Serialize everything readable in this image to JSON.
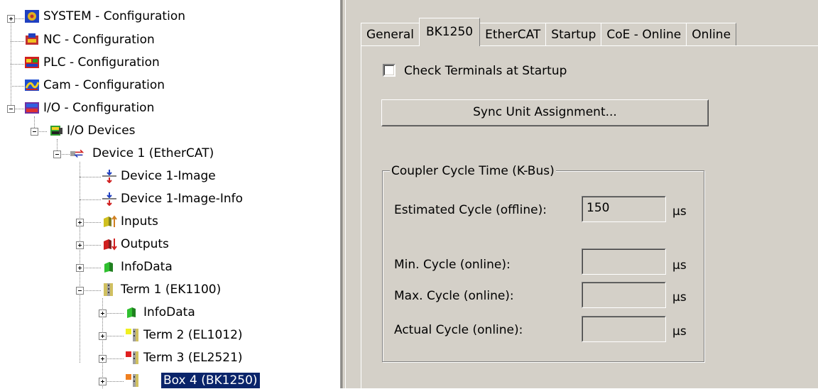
{
  "tree": {
    "nodes": [
      {
        "id": "system",
        "label": "SYSTEM - Configuration",
        "icon": "system-config-icon"
      },
      {
        "id": "nc",
        "label": "NC - Configuration",
        "icon": "nc-config-icon"
      },
      {
        "id": "plc",
        "label": "PLC - Configuration",
        "icon": "plc-config-icon"
      },
      {
        "id": "cam",
        "label": "Cam - Configuration",
        "icon": "cam-config-icon"
      },
      {
        "id": "io",
        "label": "I/O - Configuration",
        "icon": "io-config-icon"
      },
      {
        "id": "io-devices",
        "label": "I/O Devices",
        "icon": "io-devices-icon"
      },
      {
        "id": "device1",
        "label": "Device 1 (EtherCAT)",
        "icon": "ethercat-device-icon"
      },
      {
        "id": "device1-image",
        "label": "Device 1-Image",
        "icon": "process-image-icon"
      },
      {
        "id": "device1-image-info",
        "label": "Device 1-Image-Info",
        "icon": "process-image-icon"
      },
      {
        "id": "inputs",
        "label": "Inputs",
        "icon": "inputs-icon"
      },
      {
        "id": "outputs",
        "label": "Outputs",
        "icon": "outputs-icon"
      },
      {
        "id": "infodata",
        "label": "InfoData",
        "icon": "infodata-icon"
      },
      {
        "id": "term1",
        "label": "Term 1 (EK1100)",
        "icon": "terminal-icon"
      },
      {
        "id": "term1-infodata",
        "label": "InfoData",
        "icon": "infodata-icon"
      },
      {
        "id": "term2",
        "label": "Term 2 (EL1012)",
        "icon": "terminal-yellow-icon"
      },
      {
        "id": "term3",
        "label": "Term 3 (EL2521)",
        "icon": "terminal-red-icon"
      },
      {
        "id": "box4",
        "label": "Box 4 (BK1250)",
        "icon": "terminal-orange-icon",
        "selected": true
      }
    ]
  },
  "tabs": [
    {
      "label": "General",
      "active": false
    },
    {
      "label": "BK1250",
      "active": true
    },
    {
      "label": "EtherCAT",
      "active": false
    },
    {
      "label": "Startup",
      "active": false
    },
    {
      "label": "CoE - Online",
      "active": false
    },
    {
      "label": "Online",
      "active": false
    }
  ],
  "bk1250": {
    "check_terminals_label": "Check Terminals at Startup",
    "check_terminals_checked": false,
    "sync_button_label": "Sync Unit Assignment...",
    "group_title": "Coupler Cycle Time (K-Bus)",
    "estimated_label": "Estimated Cycle (offline):",
    "estimated_value": "150",
    "min_label": "Min. Cycle (online):",
    "min_value": "",
    "max_label": "Max. Cycle (online):",
    "max_value": "",
    "actual_label": "Actual Cycle (online):",
    "actual_value": "",
    "unit": "µs"
  },
  "colors": {
    "selection": "#0a246a",
    "face": "#d4d0c8"
  }
}
